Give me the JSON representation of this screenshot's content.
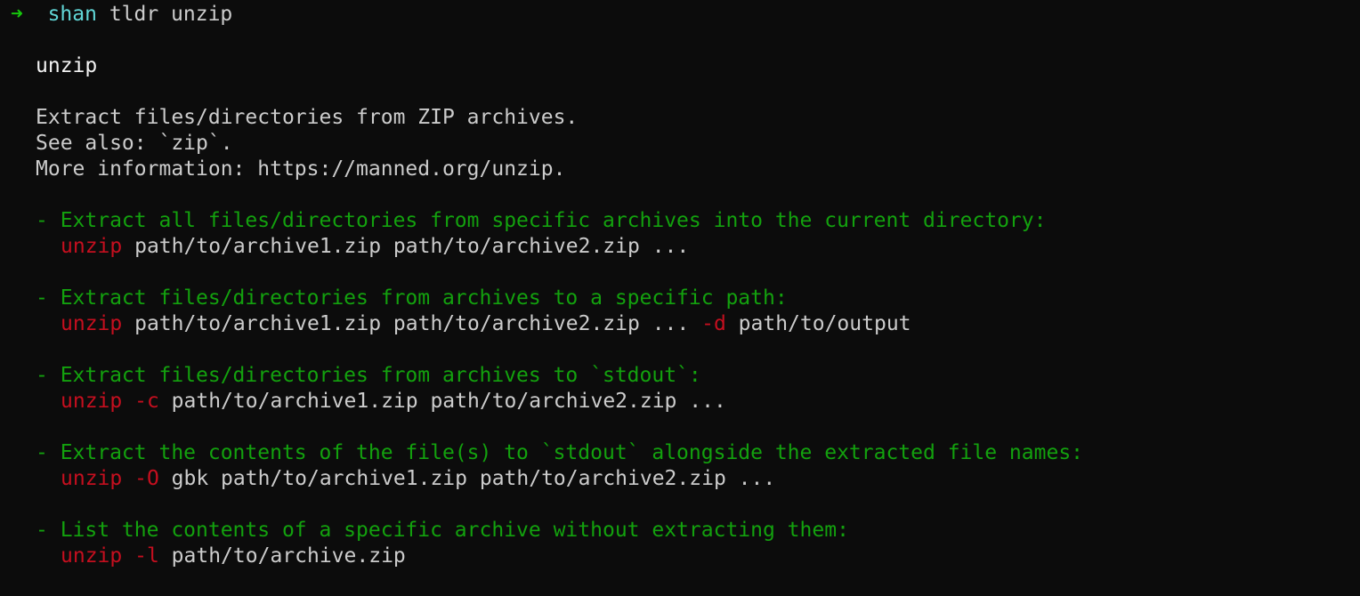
{
  "prompt": {
    "arrow": "➜",
    "user": "shan",
    "command": "tldr unzip"
  },
  "page": {
    "title": "unzip",
    "description": [
      "Extract files/directories from ZIP archives.",
      "See also: `zip`.",
      "More information: https://manned.org/unzip."
    ]
  },
  "examples": [
    {
      "description": "- Extract all files/directories from specific archives into the current directory:",
      "program": "unzip",
      "parts": [
        {
          "type": "arg",
          "text": "path/to/archive1.zip path/to/archive2.zip ..."
        }
      ]
    },
    {
      "description": "- Extract files/directories from archives to a specific path:",
      "program": "unzip",
      "parts": [
        {
          "type": "arg",
          "text": "path/to/archive1.zip path/to/archive2.zip ..."
        },
        {
          "type": "flag",
          "text": "-d"
        },
        {
          "type": "arg",
          "text": "path/to/output"
        }
      ]
    },
    {
      "description": "- Extract files/directories from archives to `stdout`:",
      "program": "unzip",
      "parts": [
        {
          "type": "flag",
          "text": "-c"
        },
        {
          "type": "arg",
          "text": "path/to/archive1.zip path/to/archive2.zip ..."
        }
      ]
    },
    {
      "description": "- Extract the contents of the file(s) to `stdout` alongside the extracted file names:",
      "program": "unzip",
      "parts": [
        {
          "type": "flag",
          "text": "-O"
        },
        {
          "type": "arg",
          "text": "gbk path/to/archive1.zip path/to/archive2.zip ..."
        }
      ]
    },
    {
      "description": "- List the contents of a specific archive without extracting them:",
      "program": "unzip",
      "parts": [
        {
          "type": "flag",
          "text": "-l"
        },
        {
          "type": "arg",
          "text": "path/to/archive.zip"
        }
      ]
    }
  ],
  "colors": {
    "background": "#0c0c0c",
    "text": "#cccccc",
    "prompt_arrow": "#16c60c",
    "prompt_user": "#61d6d6",
    "example_description": "#13a10e",
    "command_highlight": "#c50f1f"
  }
}
